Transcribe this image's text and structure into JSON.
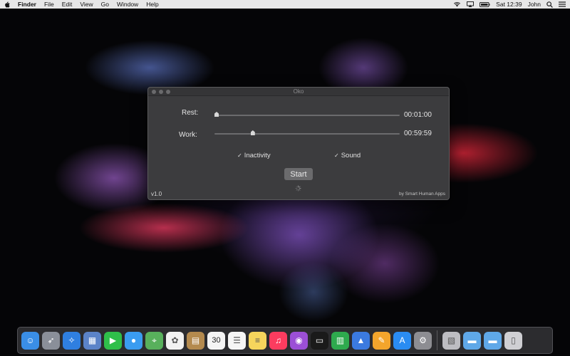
{
  "menubar": {
    "app_name": "Finder",
    "items": [
      "File",
      "Edit",
      "View",
      "Go",
      "Window",
      "Help"
    ],
    "clock": "Sat 12:39",
    "user": "John",
    "icons": [
      "apple-icon",
      "wifi-icon",
      "airplay-icon",
      "battery-icon",
      "search-icon",
      "list-icon"
    ]
  },
  "window": {
    "title": "Oko",
    "rest": {
      "label": "Rest:",
      "value": "00:01:00",
      "slider_fraction": 0.0
    },
    "work": {
      "label": "Work:",
      "value": "00:59:59",
      "slider_fraction": 0.2
    },
    "inactivity": {
      "label": "Inactivity",
      "checked": true
    },
    "sound": {
      "label": "Sound",
      "checked": true
    },
    "start_label": "Start",
    "version": "v1.0",
    "credit": "by Smart Human Apps"
  },
  "dock": {
    "apps": [
      {
        "name": "finder",
        "icon": "finder-icon",
        "color": "#3a8ee6"
      },
      {
        "name": "launchpad",
        "icon": "rocket-icon",
        "color": "#8a8f99"
      },
      {
        "name": "safari",
        "icon": "compass-icon",
        "color": "#2f7fe0"
      },
      {
        "name": "preview",
        "icon": "preview-icon",
        "color": "#5b83c8"
      },
      {
        "name": "facetime",
        "icon": "camera-icon",
        "color": "#2fbf4a"
      },
      {
        "name": "messages",
        "icon": "message-icon",
        "color": "#3a9cf0"
      },
      {
        "name": "maps",
        "icon": "map-icon",
        "color": "#58b05c"
      },
      {
        "name": "photos",
        "icon": "photos-icon",
        "color": "#f2f2f2"
      },
      {
        "name": "contacts",
        "icon": "contacts-icon",
        "color": "#b48a4e"
      },
      {
        "name": "calendar",
        "icon": "calendar-icon",
        "color": "#f4f4f4",
        "text": "30"
      },
      {
        "name": "reminders",
        "icon": "reminders-icon",
        "color": "#f5f5f5"
      },
      {
        "name": "notes",
        "icon": "notes-icon",
        "color": "#f6d55c"
      },
      {
        "name": "music",
        "icon": "music-icon",
        "color": "#fc3c5f"
      },
      {
        "name": "podcasts",
        "icon": "podcast-icon",
        "color": "#9b4fd6"
      },
      {
        "name": "tv",
        "icon": "tv-icon",
        "color": "#1a1a1a"
      },
      {
        "name": "numbers",
        "icon": "numbers-icon",
        "color": "#2eaa4e"
      },
      {
        "name": "keynote",
        "icon": "keynote-icon",
        "color": "#3b7ae0"
      },
      {
        "name": "pages",
        "icon": "pages-icon",
        "color": "#f3a52c"
      },
      {
        "name": "app-store",
        "icon": "appstore-icon",
        "color": "#2a8cf2"
      },
      {
        "name": "system-preferences",
        "icon": "gear-icon",
        "color": "#8d8d92"
      }
    ],
    "others": [
      {
        "name": "preview-doc",
        "icon": "image-file-icon",
        "color": "#bdbdc2"
      },
      {
        "name": "downloads",
        "icon": "folder-icon",
        "color": "#5fa8e8"
      },
      {
        "name": "documents",
        "icon": "folder-icon",
        "color": "#5fa8e8"
      },
      {
        "name": "trash",
        "icon": "trash-icon",
        "color": "#cfcfd3"
      }
    ]
  }
}
